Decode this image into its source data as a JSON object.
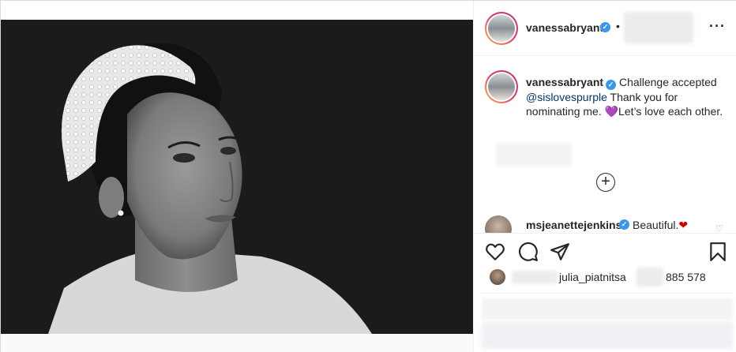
{
  "post": {
    "author": "vanessabryant",
    "header_separator": "•"
  },
  "caption": {
    "username": "vanessabryant",
    "text_before": "Challenge accepted",
    "mention": "@sislovespurple",
    "text_after_1": " Thank you for nominating me. ",
    "heart": "💜",
    "text_after_2": "Let’s love each other."
  },
  "comment": {
    "username": "msjeanettejenkins",
    "text": "Beautiful.",
    "heart": "❤",
    "like_icon": "♡"
  },
  "likes": {
    "username": "julia_piatnitsa",
    "count": "885 578"
  },
  "icons": {
    "more": "more-options-icon",
    "verified": "verified-badge-icon",
    "add": "plus-circle-icon",
    "like": "heart-icon",
    "comment": "comment-icon",
    "share": "share-icon",
    "save": "bookmark-icon"
  },
  "colors": {
    "text": "#262626",
    "verified": "#3897f0",
    "mention": "#00376b",
    "border": "#dbdbdb"
  }
}
